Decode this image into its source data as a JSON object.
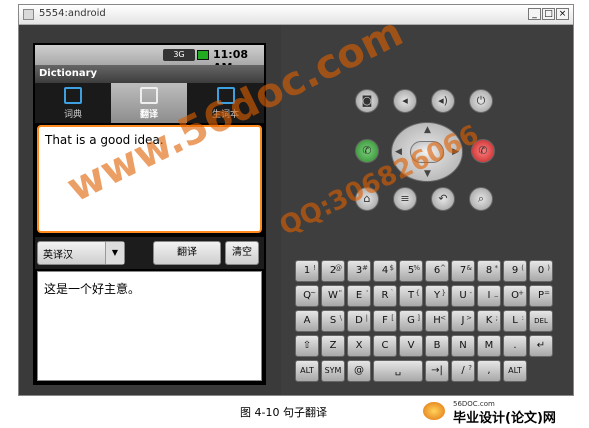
{
  "window": {
    "title": "5554:android",
    "controls": [
      "_",
      "□",
      "×"
    ]
  },
  "status_bar": {
    "network": "3G",
    "time": "11:08 AM"
  },
  "app": {
    "title": "Dictionary",
    "tabs": [
      {
        "label": "词典",
        "icon": "dictionary-icon",
        "active": false
      },
      {
        "label": "翻译",
        "icon": "translate-icon",
        "active": true
      },
      {
        "label": "生词本",
        "icon": "notebook-icon",
        "active": false
      }
    ],
    "input_text": "That is a good idea.",
    "language_select": {
      "value": "英译汉"
    },
    "translate_label": "翻译",
    "clear_label": "清空",
    "output_text": "这是一个好主意。"
  },
  "keyboard": {
    "rows": [
      [
        [
          "1",
          "!"
        ],
        [
          "2",
          "@"
        ],
        [
          "3",
          "#"
        ],
        [
          "4",
          "$"
        ],
        [
          "5",
          "%"
        ],
        [
          "6",
          "^"
        ],
        [
          "7",
          "&"
        ],
        [
          "8",
          "*"
        ],
        [
          "9",
          "("
        ],
        [
          "0",
          ")"
        ]
      ],
      [
        [
          "Q",
          "~"
        ],
        [
          "W",
          "\""
        ],
        [
          "E",
          "'"
        ],
        [
          "R",
          "`"
        ],
        [
          "T",
          "{"
        ],
        [
          "Y",
          "}"
        ],
        [
          "U",
          "-"
        ],
        [
          "I",
          "_"
        ],
        [
          "O",
          "+"
        ],
        [
          "P",
          "="
        ]
      ],
      [
        [
          "A",
          ""
        ],
        [
          "S",
          "\\"
        ],
        [
          "D",
          "|"
        ],
        [
          "F",
          "["
        ],
        [
          "G",
          "]"
        ],
        [
          "H",
          "<"
        ],
        [
          "J",
          ">"
        ],
        [
          "K",
          ";"
        ],
        [
          "L",
          ":"
        ],
        [
          "DEL",
          ""
        ]
      ],
      [
        [
          "⇧",
          ""
        ],
        [
          "Z",
          ""
        ],
        [
          "X",
          ""
        ],
        [
          "C",
          ""
        ],
        [
          "V",
          ""
        ],
        [
          "B",
          ""
        ],
        [
          "N",
          ""
        ],
        [
          "M",
          ""
        ],
        [
          ".",
          ""
        ],
        [
          "↵",
          ""
        ]
      ],
      [
        [
          "ALT",
          ""
        ],
        [
          "SYM",
          ""
        ],
        [
          "@",
          ""
        ],
        [
          "space",
          ""
        ],
        [
          "→|",
          ""
        ],
        [
          "/",
          "?"
        ],
        [
          ",",
          ""
        ],
        [
          "ALT",
          ""
        ]
      ]
    ]
  },
  "caption": "图 4-10 句子翻译",
  "watermarks": {
    "site_a": "www.56doc.com",
    "qq": "QQ:306826066"
  },
  "footer_logo": {
    "small": "56DOC.com",
    "big": "毕业设计(论文)网"
  }
}
